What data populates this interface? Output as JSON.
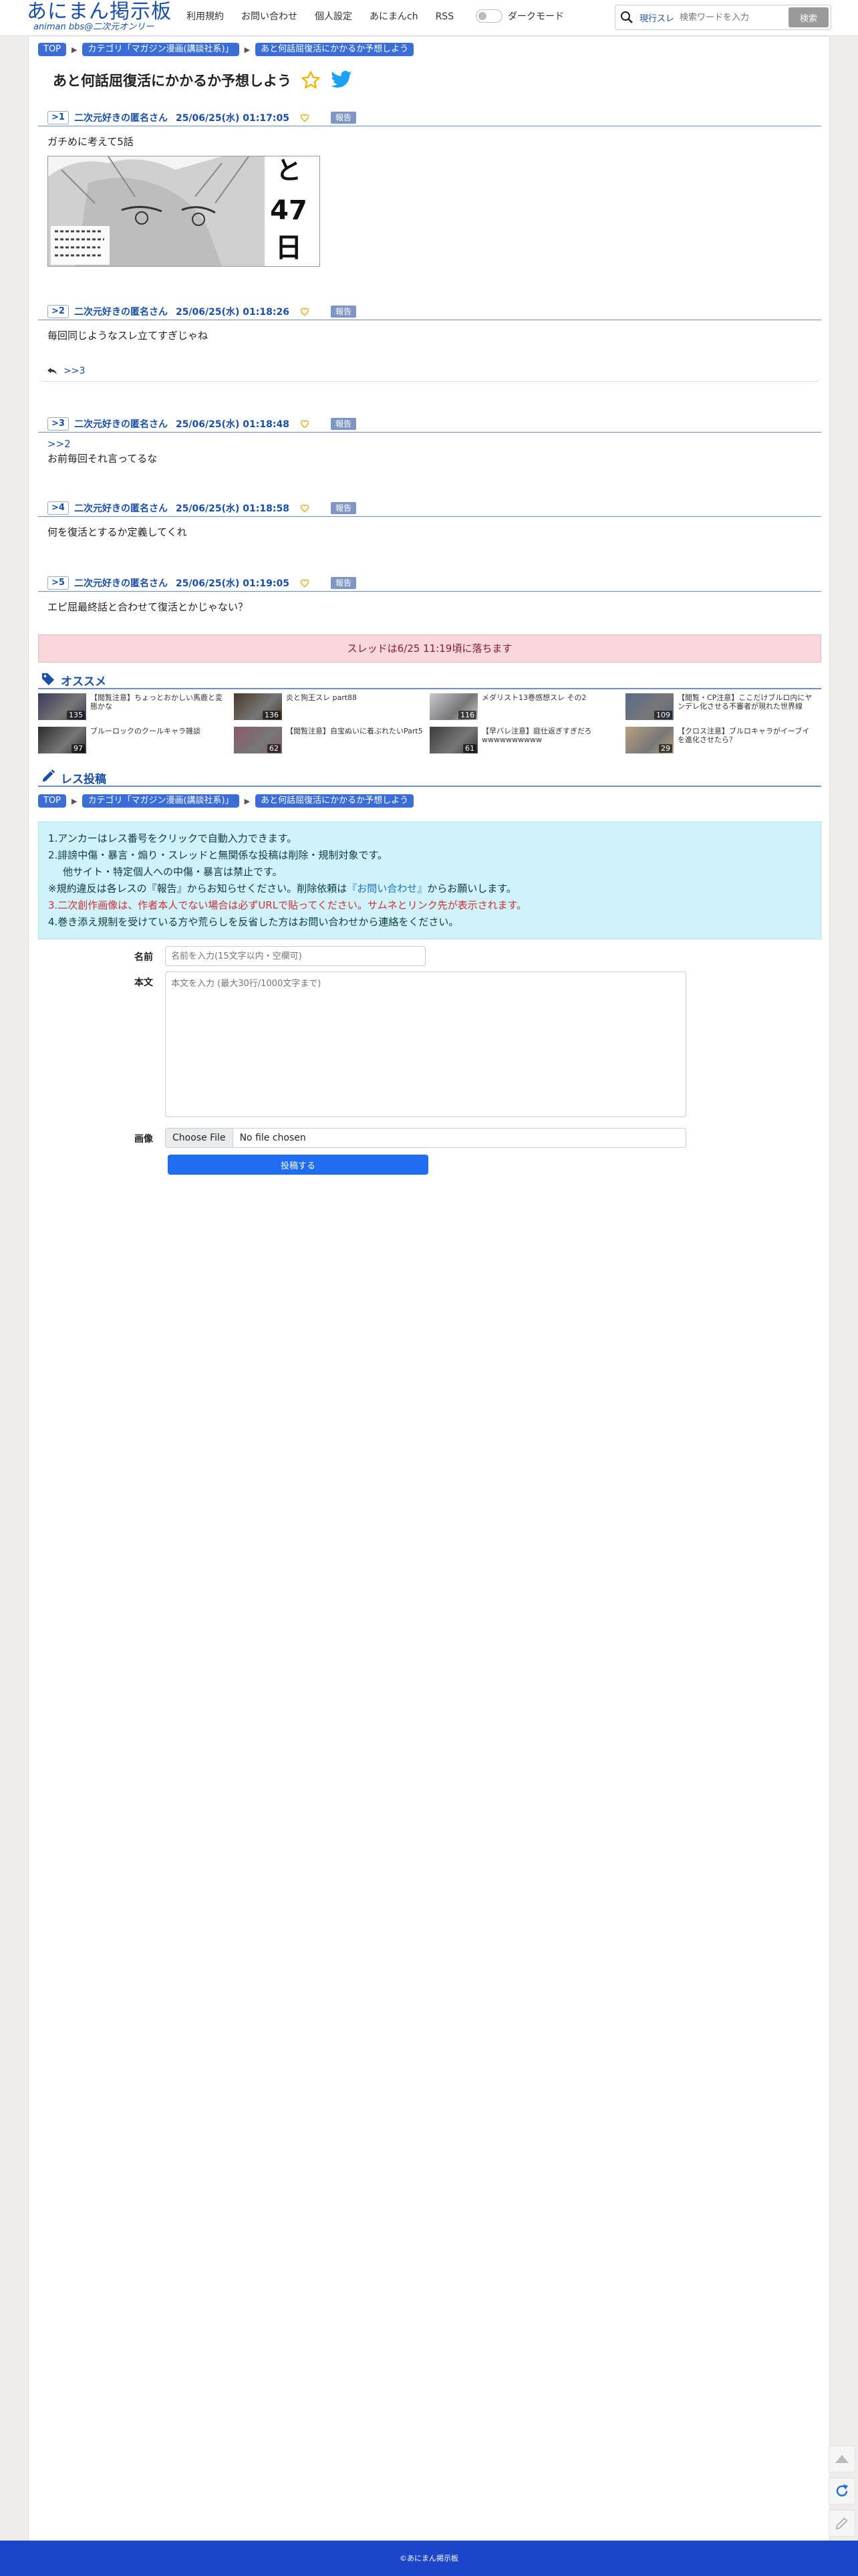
{
  "header": {
    "logo_main": "あにまん掲示板",
    "logo_sub": "animan bbs@二次元オンリー",
    "nav": [
      "利用規約",
      "お問い合わせ",
      "個人設定",
      "あにまんch",
      "RSS"
    ],
    "dark_mode_label": "ダークモード",
    "search_scope": "現行スレ",
    "search_placeholder": "検索ワードを入力",
    "search_button": "検索"
  },
  "breadcrumb": [
    "TOP",
    "カテゴリ「マガジン漫画(講談社系)」",
    "あと何話屈復活にかかるか予想しよう"
  ],
  "thread": {
    "title": "あと何話屈復活にかかるか予想しよう",
    "posts": [
      {
        "num": ">1",
        "name": "二次元好きの匿名さん",
        "date": "25/06/25(水) 01:17:05",
        "report": "報告",
        "body": "ガチめに考えて5話",
        "image_text": "と47日"
      },
      {
        "num": ">2",
        "name": "二次元好きの匿名さん",
        "date": "25/06/25(水) 01:18:26",
        "report": "報告",
        "body": "毎回同じようなスレ立てすぎじゃね",
        "reply_link": ">>3"
      },
      {
        "num": ">3",
        "name": "二次元好きの匿名さん",
        "date": "25/06/25(水) 01:18:48",
        "report": "報告",
        "anchor": ">>2",
        "body": "お前毎回それ言ってるな"
      },
      {
        "num": ">4",
        "name": "二次元好きの匿名さん",
        "date": "25/06/25(水) 01:18:58",
        "report": "報告",
        "body": "何を復活とするか定義してくれ"
      },
      {
        "num": ">5",
        "name": "二次元好きの匿名さん",
        "date": "25/06/25(水) 01:19:05",
        "report": "報告",
        "body": "エピ屈最終話と合わせて復活とかじゃない？"
      }
    ],
    "expire_notice": "スレッドは6/25 11:19頃に落ちます"
  },
  "recommend": {
    "title": "オススメ",
    "items": [
      {
        "title": "【閲覧注意】ちょっとおかしい馬鹿と変態かな",
        "count": "135",
        "color": "#3a3a5a"
      },
      {
        "title": "炎と狗王スレ part88",
        "count": "136",
        "color": "#4a3a2a"
      },
      {
        "title": "メダリスト13巻感想スレ その2",
        "count": "116",
        "color": "#c8c8d0"
      },
      {
        "title": "【閲覧・CP注意】ここだけブルロ内にヤンデレ化させる不審者が現れた世界線",
        "count": "109",
        "color": "#5a6a8a"
      },
      {
        "title": "ブルーロックのクールキャラ雑談",
        "count": "97",
        "color": "#2a2a2a"
      },
      {
        "title": "【閲覧注意】自宝ぬいに着ぶれたいPart5",
        "count": "62",
        "color": "#8a5a6a"
      },
      {
        "title": "【早バレ注意】庭仕返ぎすぎだろwwwwwwwwww",
        "count": "61",
        "color": "#3a3a3a"
      },
      {
        "title": "【クロス注意】ブルロキャラがイーブイを進化させたら？",
        "count": "29",
        "color": "#b8a080"
      }
    ]
  },
  "reply_form": {
    "title": "レス投稿",
    "rules": [
      {
        "text": "1.アンカーはレス番号をクリックで自動入力できます。"
      },
      {
        "text": "2.誹謗中傷・暴言・煽り・スレッドと無関係な投稿は削除・規制対象です。"
      },
      {
        "text": "他サイト・特定個人への中傷・暴言は禁止です。"
      },
      {
        "text": "※規約違反は各レスの『報告』からお知らせください。削除依頼は",
        "link": "『お問い合わせ』",
        "after": "からお願いします。"
      },
      {
        "text": "3.二次創作画像は、作者本人でない場合は必ずURLで貼ってください。サムネとリンク先が表示されます。"
      },
      {
        "text": "4.巻き添え規制を受けている方や荒らしを反省した方はお問い合わせから連絡をください。"
      }
    ],
    "name_label": "名前",
    "name_placeholder": "名前を入力(15文字以内・空欄可)",
    "body_label": "本文",
    "body_placeholder": "本文を入力 (最大30行/1000文字まで)",
    "image_label": "画像",
    "file_button": "Choose File",
    "file_status": "No file chosen",
    "submit": "投稿する"
  },
  "footer": {
    "copyright": "©あにまん掲示板"
  },
  "colors": {
    "brand": "#1a4fa8",
    "crumb": "#3a6dd6",
    "footer": "#1b46c9",
    "submit": "#1d6cf2",
    "notice_bg": "#f8d7dc",
    "info_bg": "#cff3f9"
  }
}
